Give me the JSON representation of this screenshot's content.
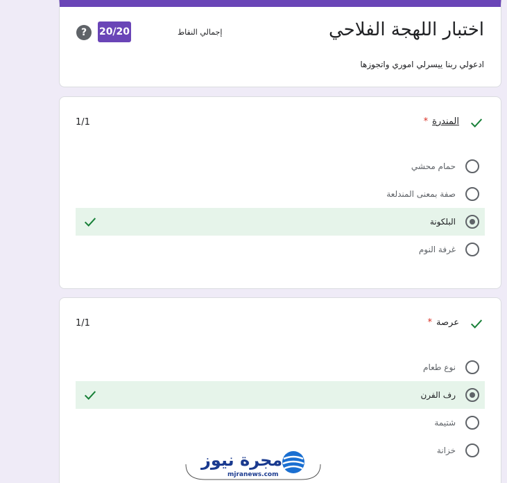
{
  "form": {
    "title": "اختبار اللهجة الفلاحي",
    "description": "ادعولي ربنا ييسرلي اموري واتجوزها",
    "points_label": "إجمالي النقاط",
    "score": "20/20"
  },
  "questions": [
    {
      "title": "المندرة",
      "required_mark": "*",
      "score": "1/1",
      "options": [
        {
          "label": "حمام محشي"
        },
        {
          "label": "صفة بمعنى المندلعة"
        },
        {
          "label": "البلكونة"
        },
        {
          "label": "غرفة النوم"
        }
      ]
    },
    {
      "title": "عرصة",
      "required_mark": "*",
      "score": "1/1",
      "options": [
        {
          "label": "نوع طعام"
        },
        {
          "label": "رف الفرن"
        },
        {
          "label": "شتيمة"
        },
        {
          "label": "خزانة"
        }
      ]
    }
  ],
  "watermark": {
    "text": "مجرة نيوز",
    "sub": "mjranews.com"
  },
  "colors": {
    "accent": "#6a45b7",
    "correct_bg": "#e6f4ea",
    "correct_check": "#188038",
    "required": "#d93025"
  }
}
